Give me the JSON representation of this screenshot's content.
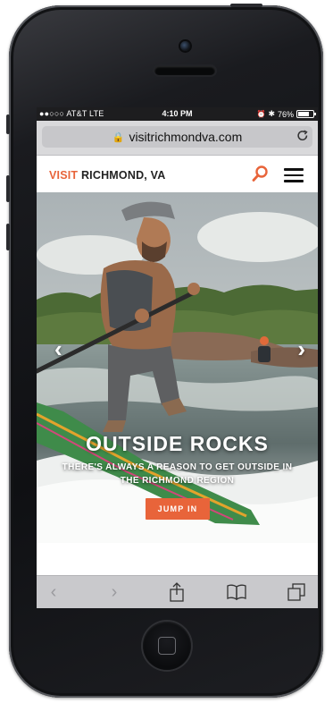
{
  "status_bar": {
    "carrier": "●●○○○ AT&T  LTE",
    "time": "4:10 PM",
    "battery": "76%",
    "battery_level": 0.76
  },
  "browser": {
    "url": "visitrichmondva.com"
  },
  "site_header": {
    "logo_visit": "VISIT",
    "logo_city": "RICHMOND, VA"
  },
  "hero": {
    "title": "OUTSIDE ROCKS",
    "subtitle": "THERE'S ALWAYS A REASON TO GET OUTSIDE IN THE RICHMOND REGION",
    "cta_label": "JUMP IN",
    "prev_arrow": "‹",
    "next_arrow": "›"
  },
  "toolbar": {
    "back": "‹",
    "forward": "›"
  },
  "colors": {
    "accent": "#e8643a",
    "phone_body": "#111214",
    "status_bar": "#1d1d1f"
  },
  "icons": [
    "lock-icon",
    "reload-icon",
    "search-icon",
    "hamburger-menu-icon",
    "share-icon",
    "bookmarks-icon",
    "tabs-icon"
  ]
}
